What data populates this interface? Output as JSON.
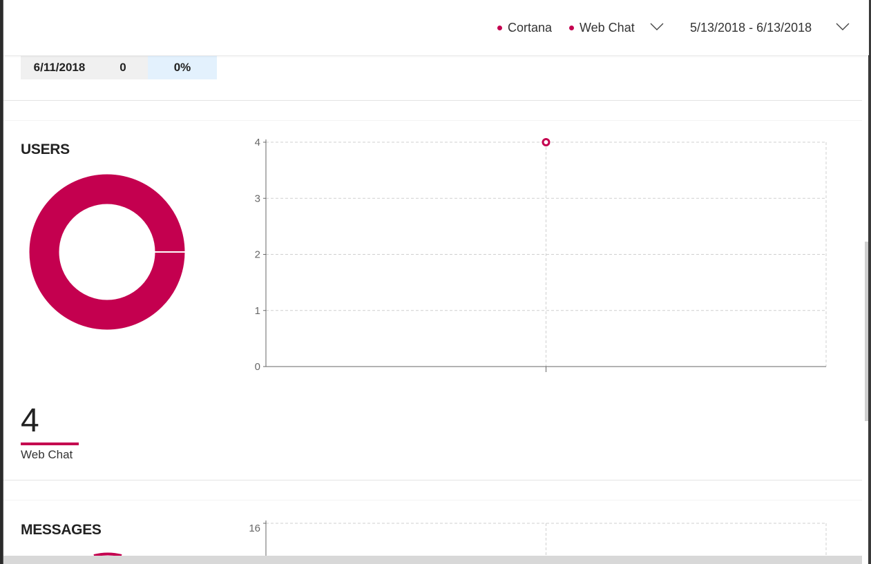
{
  "header": {
    "legend": [
      {
        "label": "Cortana",
        "color": "#c4004f"
      },
      {
        "label": "Web Chat",
        "color": "#c4004f"
      }
    ],
    "channel_dropdown_icon": "chevron-down-icon",
    "date_range": "5/13/2018 - 6/13/2018",
    "date_dropdown_icon": "chevron-down-icon"
  },
  "table": {
    "row": {
      "date": "6/11/2018",
      "count": "0",
      "percent": "0%"
    }
  },
  "users": {
    "title": "USERS",
    "donut": {
      "share": 1.0,
      "color": "#c4004f"
    },
    "total": "4",
    "total_label": "Web Chat",
    "chart_data": {
      "type": "line",
      "title": "",
      "xlabel": "",
      "ylabel": "",
      "ylim": [
        0,
        4
      ],
      "yticks": [
        "0",
        "1",
        "2",
        "3",
        "4"
      ],
      "x": [
        ""
      ],
      "series": [
        {
          "values": [
            4
          ],
          "color": "#c4004f"
        }
      ],
      "grid": true
    }
  },
  "messages": {
    "title": "MESSAGES",
    "chart_data": {
      "type": "line",
      "ylim": [
        0,
        16
      ],
      "yticks": [
        "16"
      ],
      "grid": true
    }
  }
}
